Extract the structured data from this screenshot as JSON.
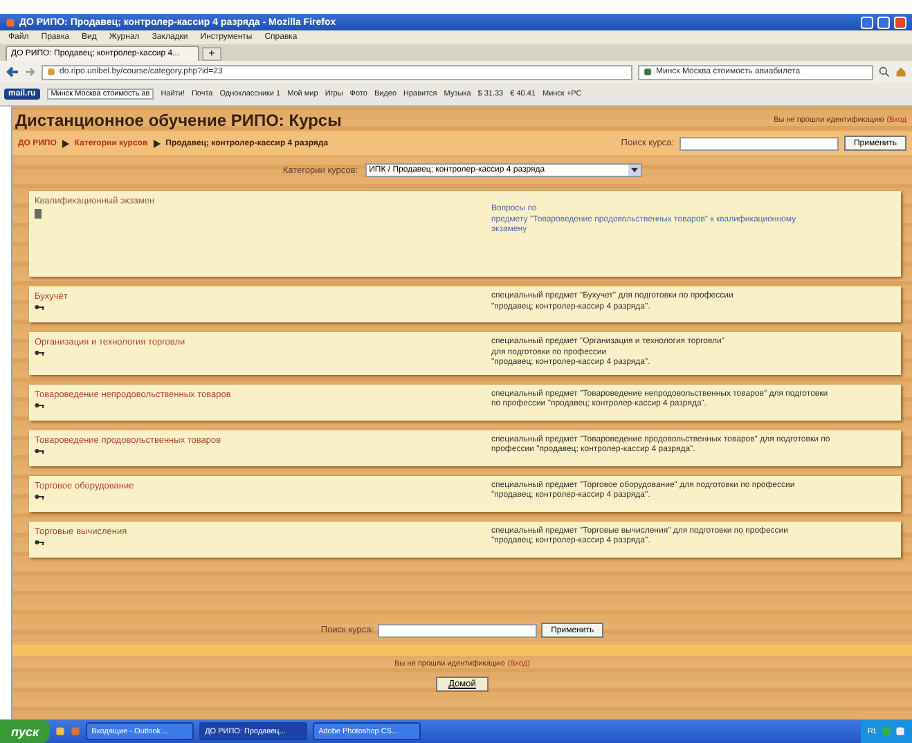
{
  "window": {
    "title": "ДО РИПО: Продавец; контролер-кассир 4 разряда - Mozilla Firefox"
  },
  "menu": [
    "Файл",
    "Правка",
    "Вид",
    "Журнал",
    "Закладки",
    "Инструменты",
    "Справка"
  ],
  "tabs": [
    {
      "label": "ДО РИПО: Продавец; контролер-кассир 4...",
      "selected": true
    }
  ],
  "new_tab": "+",
  "address_bar": {
    "value": "do.ripo.unibel.by/course/category.php?id=23"
  },
  "search_bar": {
    "value": "Минск Москва стоимость авиабилета"
  },
  "bookmarks": [
    {
      "label": "mail.ru",
      "kind": "logo"
    },
    {
      "label": "Минск Москва стоимость ав",
      "kind": "field"
    },
    {
      "label": "Найти!",
      "kind": "plain"
    },
    {
      "label": "Почта",
      "kind": "plain"
    },
    {
      "label": "Одноклассники 1",
      "kind": "plain"
    },
    {
      "label": "Мой мир",
      "kind": "plain"
    },
    {
      "label": "Игры",
      "kind": "plain"
    },
    {
      "label": "Фото",
      "kind": "plain"
    },
    {
      "label": "Видео",
      "kind": "plain"
    },
    {
      "label": "Нравится",
      "kind": "plain"
    },
    {
      "label": "Музыка",
      "kind": "plain"
    },
    {
      "label": "$ 31.33",
      "kind": "plain"
    },
    {
      "label": "€ 40.41",
      "kind": "plain"
    },
    {
      "label": "Минск +PC",
      "kind": "plain"
    }
  ],
  "page": {
    "title": "Дистанционное обучение РИПО: Курсы",
    "login_text": "Вы не прошли идентификацию",
    "login_link": "(Вход"
  },
  "breadcrumb": [
    "ДО РИПО",
    "Категории курсов",
    "Продавец; контролер-кассир 4 разряда"
  ],
  "search": {
    "label": "Поиск курса:",
    "button": "Применить"
  },
  "category": {
    "label": "Категории курсов:",
    "value": "ИПК / Продавец; контролер-кассир 4 разряда"
  },
  "courses": [
    {
      "kind": "exam",
      "name": "Квалификационный экзамен",
      "description": "Вопросы по\nпредмету \"Товароведение продовольственных товаров\" к квалификационному\nэкзамену"
    },
    {
      "kind": "course",
      "name": "Бухучёт",
      "description": "специальный предмет \"Бухучет\" для подготовки по профессии\n\"продавец; контролер-кассир 4 разряда\"."
    },
    {
      "kind": "course",
      "name": "Организация и технология торговли",
      "description": "специальный предмет \"Организация и технология торговли\"\nдля подготовки по профессии\n\"продавец; контролер-кассир 4 разряда\"."
    },
    {
      "kind": "course",
      "name": "Товароведение непродовольственных товаров",
      "description": "специальный предмет \"Товароведение непродовольственных товаров\" для подготовки\nпо профессии \"продавец; контролер-кассир 4 разряда\"."
    },
    {
      "kind": "course",
      "name": "Товароведение продовольственных товаров",
      "description": "специальный предмет \"Товароведение продовольственных товаров\" для подготовки по\nпрофессии \"продавец; контролер-кассир 4 разряда\"."
    },
    {
      "kind": "course",
      "name": "Торговое оборудование",
      "description": "специальный предмет \"Торговое оборудование\" для подготовки по профессии\n\"продавец; контролер-кассир 4 разряда\"."
    },
    {
      "kind": "course",
      "name": "Торговые вычисления",
      "description": "специальный предмет \"Торговые вычисления\" для подготовки по профессии\n\"продавец; контролер-кассир 4 разряда\"."
    }
  ],
  "bottom_search": {
    "label": "Поиск курса:",
    "button": "Применить"
  },
  "footer": {
    "text": "Вы не прошли идентификацию",
    "link": "(Вход)"
  },
  "home_button": "Домой",
  "taskbar": {
    "start": "пуск",
    "tasks": [
      {
        "label": "Входящие - Outlook ...",
        "selected": false
      },
      {
        "label": "ДО РИПО: Продавец...",
        "selected": true
      },
      {
        "label": "Adobe Photoshop CS...",
        "selected": false
      }
    ],
    "language": "RL"
  }
}
